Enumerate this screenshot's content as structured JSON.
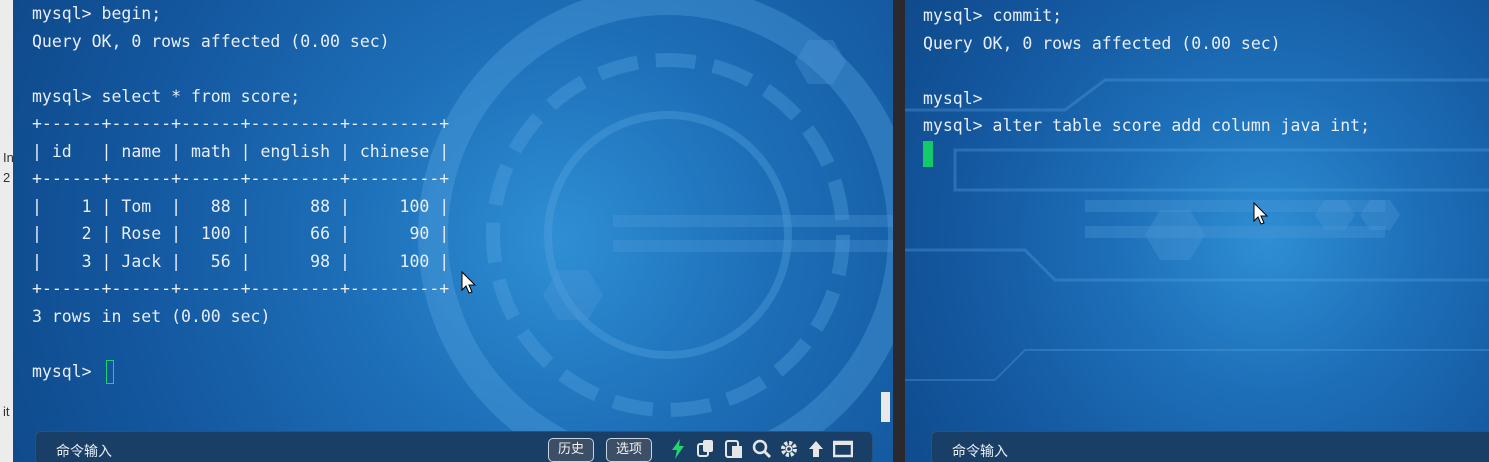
{
  "left_edge": {
    "glyph_1": "In",
    "glyph_2": "2",
    "glyph_3": "it"
  },
  "left_terminal": {
    "lines": [
      "mysql> begin;",
      "Query OK, 0 rows affected (0.00 sec)",
      "",
      "mysql> select * from score;",
      "+------+------+------+---------+---------+",
      "| id   | name | math | english | chinese |",
      "+------+------+------+---------+---------+",
      "|    1 | Tom  |   88 |      88 |     100 |",
      "|    2 | Rose |  100 |      66 |      90 |",
      "|    3 | Jack |   56 |      98 |     100 |",
      "+------+------+------+---------+---------+",
      "3 rows in set (0.00 sec)",
      "",
      "mysql> "
    ],
    "command_bar": {
      "label": "命令输入",
      "history_button": "历史",
      "options_button": "选项"
    }
  },
  "right_terminal": {
    "lines": [
      "mysql> commit;",
      "Query OK, 0 rows affected (0.00 sec)",
      "",
      "mysql>",
      "mysql> alter table score add column java int;"
    ],
    "command_bar": {
      "label": "命令输入"
    }
  },
  "colors": {
    "cursor": "#13c96a",
    "terminal_text": "#e8eef6",
    "background": "#1d6fb8"
  },
  "icons": [
    "lightning-icon",
    "copy-icon",
    "paste-icon",
    "search-icon",
    "gear-icon",
    "upload-icon",
    "window-icon",
    "mouse-pointer-icon"
  ]
}
